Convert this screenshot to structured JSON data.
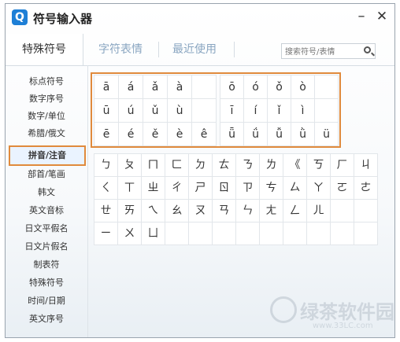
{
  "window": {
    "app_icon": "Q",
    "title": "符号输入器",
    "minimize": "–",
    "close": "✕"
  },
  "tabs": [
    {
      "label": "特殊符号",
      "active": true
    },
    {
      "label": "字符表情",
      "active": false
    },
    {
      "label": "最近使用",
      "active": false
    }
  ],
  "search": {
    "placeholder": "搜索符号/表情"
  },
  "sidebar": {
    "items": [
      {
        "label": "标点符号"
      },
      {
        "label": "数字序号"
      },
      {
        "label": "数字/单位"
      },
      {
        "label": "希腊/俄文"
      },
      {
        "label": "拼音/注音",
        "active": true
      },
      {
        "label": "部首/笔画"
      },
      {
        "label": "韩文"
      },
      {
        "label": "英文音标"
      },
      {
        "label": "日文平假名"
      },
      {
        "label": "日文片假名"
      },
      {
        "label": "制表符"
      },
      {
        "label": "特殊符号"
      },
      {
        "label": "时间/日期"
      },
      {
        "label": "英文序号"
      }
    ]
  },
  "pinyin_left": [
    [
      "ā",
      "á",
      "ǎ",
      "à",
      ""
    ],
    [
      "ū",
      "ú",
      "ǔ",
      "ù",
      ""
    ],
    [
      "ē",
      "é",
      "ě",
      "è",
      "ê"
    ]
  ],
  "pinyin_right": [
    [
      "ō",
      "ó",
      "ǒ",
      "ò",
      ""
    ],
    [
      "ī",
      "í",
      "ǐ",
      "ì",
      ""
    ],
    [
      "ǖ",
      "ǘ",
      "ǚ",
      "ǜ",
      "ü"
    ]
  ],
  "zhuyin": [
    [
      "ㄅ",
      "ㄆ",
      "ㄇ",
      "ㄈ",
      "ㄉ",
      "ㄊ",
      "ㄋ",
      "ㄌ",
      "《",
      "ㄎ",
      "ㄏ",
      "ㄐ"
    ],
    [
      "ㄑ",
      "ㄒ",
      "ㄓ",
      "ㄔ",
      "ㄕ",
      "ㄖ",
      "ㄗ",
      "ㄘ",
      "ㄙ",
      "ㄚ",
      "ㄛ",
      "ㄜ"
    ],
    [
      "ㄝ",
      "ㄞ",
      "ㄟ",
      "ㄠ",
      "ㄡ",
      "ㄢ",
      "ㄣ",
      "ㄤ",
      "ㄥ",
      "ㄦ",
      "",
      ""
    ],
    [
      "ㄧ",
      "ㄨ",
      "ㄩ",
      "",
      "",
      "",
      "",
      "",
      "",
      "",
      "",
      ""
    ]
  ],
  "watermark": {
    "main": "绿茶软件园",
    "sub": "www.33LC.com"
  }
}
